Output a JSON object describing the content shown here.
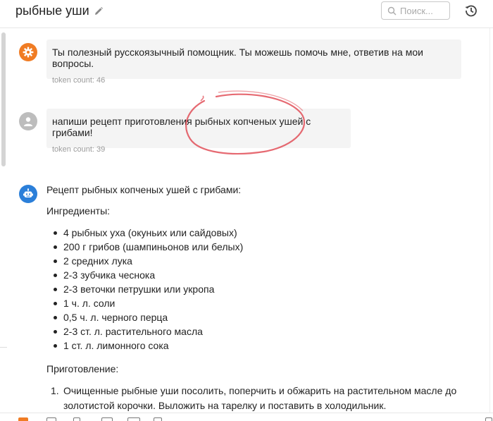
{
  "header": {
    "title": "рыбные уши",
    "search_placeholder": "Поиск..."
  },
  "messages": {
    "system": {
      "text": "Ты полезный русскоязычный помощник. Ты можешь помочь мне, ответив на мои вопросы.",
      "token_count": "token count: 46"
    },
    "user": {
      "text": "напиши рецепт приготовления рыбных копченых ушей с грибами!",
      "token_count": "token count: 39"
    },
    "assistant": {
      "intro": "Рецепт рыбных копченых ушей с грибами:",
      "ingredients_heading": "Ингредиенты:",
      "ingredients": [
        "4 рыбных уха (окуньих или сайдовых)",
        "200 г грибов (шампиньонов или белых)",
        "2 средних лука",
        "2-3 зубчика чеснока",
        "2-3 веточки петрушки или укропа",
        "1 ч. л. соли",
        "0,5 ч. л. черного перца",
        "2-3 ст. л. растительного масла",
        "1 ст. л. лимонного сока"
      ],
      "preparation_heading": "Приготовление:",
      "steps": [
        {
          "num": "1.",
          "text": "Очищенные рыбные уши посолить, поперчить и обжарить на растительном масле до золотистой корочки. Выложить на тарелку и поставить в холодильник."
        }
      ]
    }
  },
  "colors": {
    "system_avatar": "#f07c24",
    "user_avatar": "#bdbdbd",
    "assistant_avatar": "#2b7fd9",
    "annotation": "#e0454f"
  },
  "icons": {
    "system_avatar": "gear-icon",
    "user_avatar": "user-icon",
    "assistant_avatar": "robot-icon",
    "edit": "pencil-icon",
    "search": "search-icon",
    "history": "history-icon"
  }
}
